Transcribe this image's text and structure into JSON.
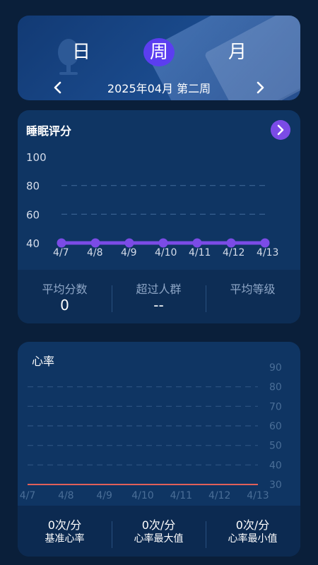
{
  "header": {
    "tabs": [
      {
        "label": "日"
      },
      {
        "label": "周"
      },
      {
        "label": "月"
      }
    ],
    "active_tab": "周",
    "period_label": "2025年04月 第二周",
    "accent_color": "#5b3ef0"
  },
  "sleep": {
    "title": "睡眠评分",
    "stats": [
      {
        "label": "平均分数",
        "value": "0"
      },
      {
        "label": "超过人群",
        "value": "--"
      },
      {
        "label": "平均等级",
        "value": ""
      }
    ]
  },
  "heart": {
    "title": "心率",
    "stats": [
      {
        "value": "0次/分",
        "label": "基准心率"
      },
      {
        "value": "0次/分",
        "label": "心率最大值"
      },
      {
        "value": "0次/分",
        "label": "心率最小值"
      }
    ]
  },
  "chart_data": [
    {
      "type": "line",
      "title": "睡眠评分",
      "categories": [
        "4/7",
        "4/8",
        "4/9",
        "4/10",
        "4/11",
        "4/12",
        "4/13"
      ],
      "y_ticks": [
        "100",
        "80",
        "60",
        "40"
      ],
      "ylim": [
        40,
        100
      ],
      "series": [
        {
          "values": [
            40,
            40,
            40,
            40,
            40,
            40,
            40
          ],
          "color": "#7b4be6"
        }
      ],
      "grid": true
    },
    {
      "type": "line",
      "title": "心率",
      "categories": [
        "4/7",
        "4/8",
        "4/9",
        "4/10",
        "4/11",
        "4/12",
        "4/13"
      ],
      "y_ticks": [
        "90",
        "80",
        "70",
        "60",
        "50",
        "40",
        "30"
      ],
      "ylim": [
        30,
        90
      ],
      "series": [
        {
          "values": [
            30,
            30,
            30,
            30,
            30,
            30,
            30
          ],
          "color": "#e0605a"
        }
      ],
      "grid": true
    }
  ]
}
